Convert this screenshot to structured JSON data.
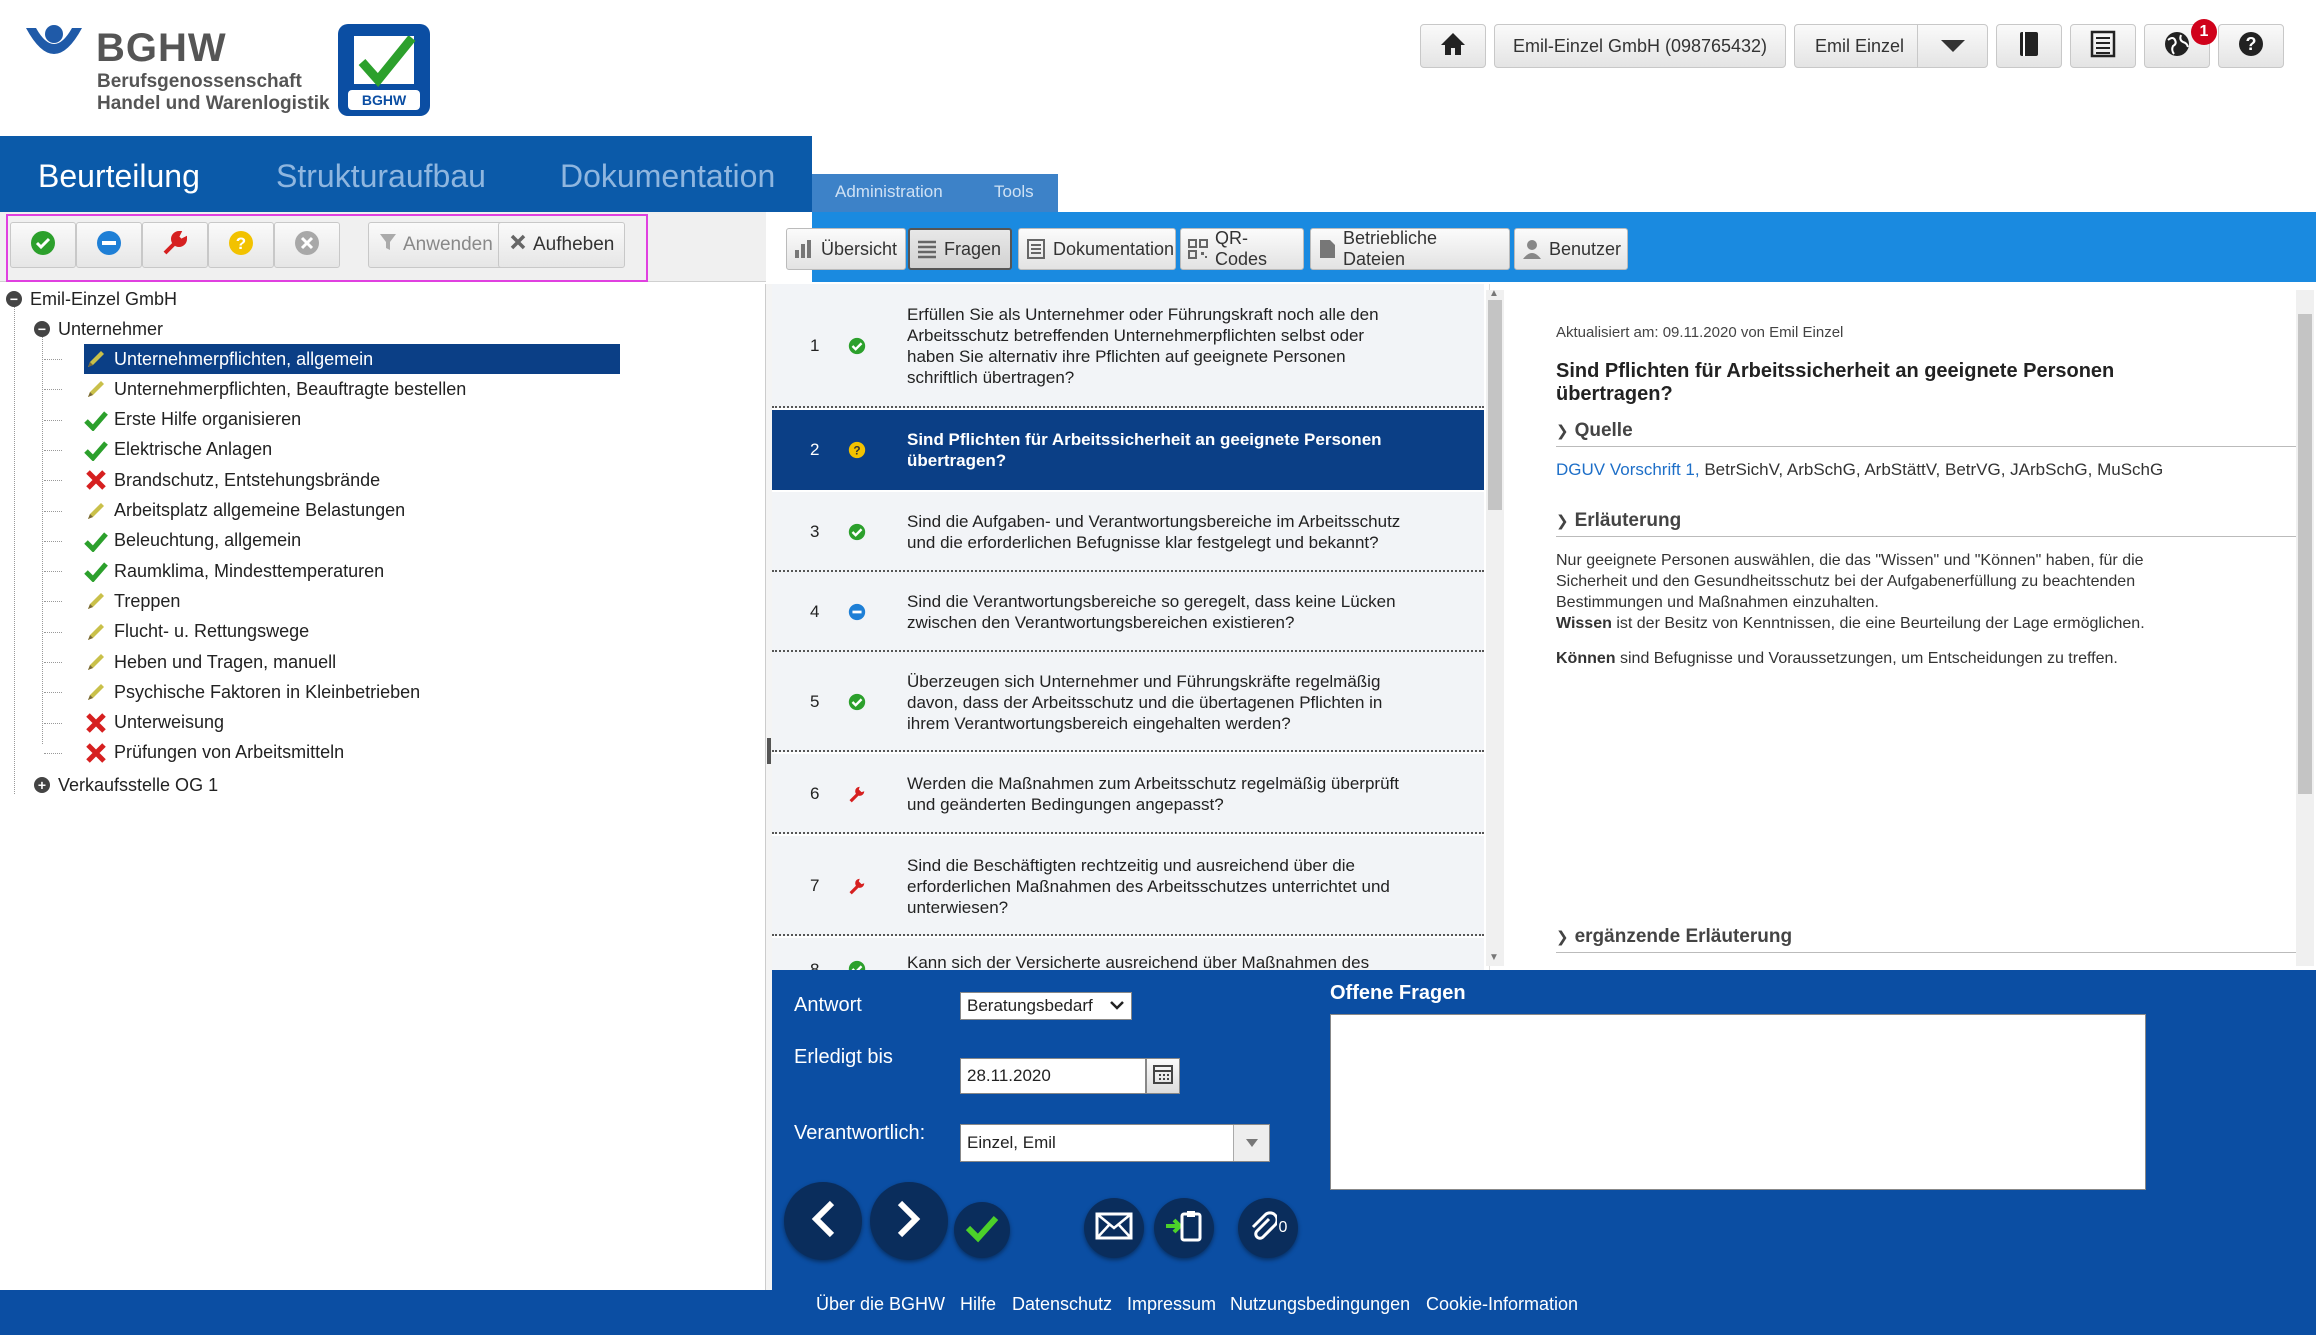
{
  "header": {
    "logo_name": "BGHW",
    "logo_line1": "Berufsgenossenschaft",
    "logo_line2": "Handel und Warenlogistik",
    "badge_logo_text": "BGHW",
    "company_button": "Emil-Einzel GmbH (098765432)",
    "user_button": "Emil Einzel",
    "notification_count": "1"
  },
  "nav": {
    "tabs": [
      "Beurteilung",
      "Strukturaufbau",
      "Dokumentation"
    ],
    "subtabs": [
      "Administration",
      "Tools"
    ]
  },
  "toolbar": {
    "apply_label": "Anwenden",
    "reset_label": "Aufheben"
  },
  "tree": {
    "root": "Emil-Einzel GmbH",
    "group": "Unternehmer",
    "items": [
      {
        "label": "Unternehmerpflichten, allgemein",
        "status": "pencil"
      },
      {
        "label": "Unternehmerpflichten, Beauftragte bestellen",
        "status": "pencil"
      },
      {
        "label": "Erste Hilfe organisieren",
        "status": "check"
      },
      {
        "label": "Elektrische Anlagen",
        "status": "check"
      },
      {
        "label": "Brandschutz, Entstehungsbrände",
        "status": "cross"
      },
      {
        "label": "Arbeitsplatz allgemeine Belastungen",
        "status": "pencil"
      },
      {
        "label": "Beleuchtung, allgemein",
        "status": "check"
      },
      {
        "label": "Raumklima, Mindesttemperaturen",
        "status": "check"
      },
      {
        "label": "Treppen",
        "status": "pencil"
      },
      {
        "label": "Flucht- u. Rettungswege",
        "status": "pencil"
      },
      {
        "label": "Heben und Tragen, manuell",
        "status": "pencil"
      },
      {
        "label": "Psychische Faktoren in Kleinbetrieben",
        "status": "pencil"
      },
      {
        "label": "Unterweisung",
        "status": "cross"
      },
      {
        "label": "Prüfungen von Arbeitsmitteln",
        "status": "cross"
      }
    ],
    "sibling": "Verkaufsstelle OG 1"
  },
  "right_tabs": [
    "Übersicht",
    "Fragen",
    "Dokumentation",
    "QR-Codes",
    "Betriebliche Dateien",
    "Benutzer"
  ],
  "questions": [
    {
      "num": "1",
      "status": "check",
      "lines": [
        "Erfüllen Sie als Unternehmer oder Führungskraft noch alle den",
        "Arbeitsschutz betreffenden Unternehmerpflichten selbst oder",
        "haben Sie alternativ ihre Pflichten auf geeignete Personen",
        "schriftlich übertragen?"
      ]
    },
    {
      "num": "2",
      "status": "question",
      "lines": [
        "Sind Pflichten für Arbeitssicherheit an geeignete Personen",
        "übertragen?"
      ]
    },
    {
      "num": "3",
      "status": "check",
      "lines": [
        "Sind die Aufgaben- und Verantwortungsbereiche im Arbeitsschutz",
        "und die erforderlichen Befugnisse klar festgelegt und bekannt?"
      ]
    },
    {
      "num": "4",
      "status": "minus",
      "lines": [
        "Sind die Verantwortungsbereiche so geregelt, dass keine Lücken",
        "zwischen den Verantwortungsbereichen existieren?"
      ]
    },
    {
      "num": "5",
      "status": "check",
      "lines": [
        "Überzeugen sich Unternehmer und Führungskräfte regelmäßig",
        "davon, dass der Arbeitsschutz und die übertagenen Pflichten in",
        "ihrem Verantwortungsbereich eingehalten werden?"
      ]
    },
    {
      "num": "6",
      "status": "wrench",
      "lines": [
        "Werden die Maßnahmen zum Arbeitsschutz regelmäßig überprüft",
        "und geänderten Bedingungen angepasst?"
      ]
    },
    {
      "num": "7",
      "status": "wrench",
      "lines": [
        "Sind die Beschäftigten rechtzeitig und ausreichend über die",
        "erforderlichen Maßnahmen des Arbeitsschutzes unterrichtet und",
        "unterwiesen?"
      ]
    },
    {
      "num": "8",
      "status": "check",
      "lines": [
        "Kann sich der Versicherte ausreichend über Maßnahmen des"
      ]
    }
  ],
  "detail": {
    "updated": "Aktualisiert am: 09.11.2020 von Emil Einzel",
    "title_lines": [
      "Sind Pflichten für Arbeitssicherheit an geeignete Personen",
      "übertragen?"
    ],
    "source_heading": "Quelle",
    "source_link": "DGUV Vorschrift 1,",
    "source_rest": " BetrSichV, ArbSchG, ArbStättV, BetrVG, JArbSchG, MuSchG",
    "explain_heading": "Erläuterung",
    "explain_lines": [
      "Nur geeignete Personen auswählen,  die das \"Wissen\" und \"Können\" haben, für die",
      "Sicherheit und den Gesundheitsschutz bei der Aufgabenerfüllung zu beachtenden",
      "Bestimmungen und Maßnahmen einzuhalten."
    ],
    "wissen_bold": "Wissen",
    "wissen_rest": " ist der Besitz von Kenntnissen, die eine Beurteilung der Lage ermöglichen.",
    "koennen_bold": "Können",
    "koennen_rest": " sind Befugnisse und Voraussetzungen, um Entscheidungen zu treffen.",
    "extra_heading": "ergänzende Erläuterung"
  },
  "answer": {
    "antwort_label": "Antwort",
    "antwort_value": "Beratungsbedarf",
    "erledigt_label": "Erledigt bis",
    "erledigt_value": "28.11.2020",
    "verantwortlich_label": "Verantwortlich:",
    "verantwortlich_value": "Einzel, Emil",
    "offene_label": "Offene Fragen",
    "offene_value": "",
    "attachment_count": "0"
  },
  "footer": {
    "links": [
      "Über die BGHW",
      "Hilfe",
      "Datenschutz",
      "Impressum",
      "Nutzungsbedingungen",
      "Cookie-Information"
    ]
  },
  "colors": {
    "nav_blue": "#0b5aa9",
    "selection": "#0b3f86",
    "panel_blue": "#0b4ea3",
    "status_green": "#2ca02c",
    "status_red": "#d62020",
    "status_yellow": "#f2c200",
    "status_blue": "#1e7fd6"
  }
}
